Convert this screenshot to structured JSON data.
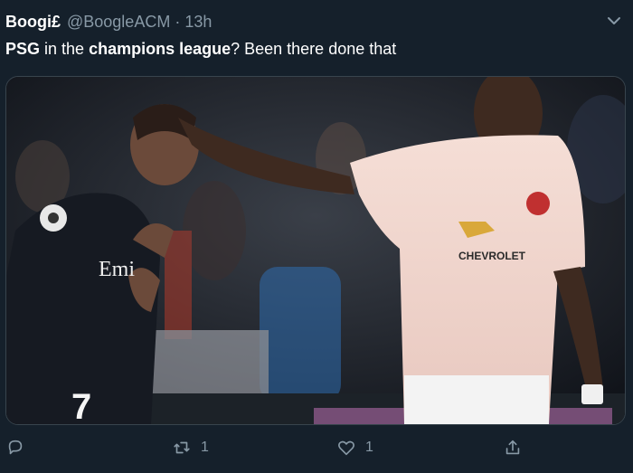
{
  "tweet": {
    "display_name": "Boogi£",
    "handle": "@BoogleACM",
    "separator": "·",
    "time": "13h",
    "text_parts": [
      {
        "text": "PSG",
        "bold": true
      },
      {
        "text": " in the ",
        "bold": false
      },
      {
        "text": "champions league",
        "bold": true
      },
      {
        "text": "? Been there done that",
        "bold": false
      }
    ]
  },
  "media": {
    "description_icon": "photo",
    "jersey_number": "7",
    "sponsor_left": "Emi",
    "sponsor_right": "CHEVROLET"
  },
  "actions": {
    "reply_count": "",
    "retweet_count": "1",
    "like_count": "1",
    "share_count": ""
  },
  "colors": {
    "background": "#15202b",
    "muted": "#8899a6",
    "text": "#ffffff"
  },
  "icons": [
    "chevron-down-icon",
    "reply-icon",
    "retweet-icon",
    "heart-icon",
    "share-icon"
  ]
}
